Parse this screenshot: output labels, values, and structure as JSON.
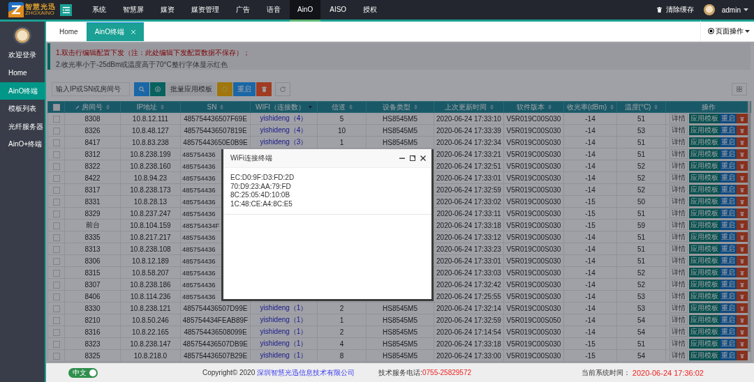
{
  "top_nav": {
    "logo": {
      "title": "智慧光迅",
      "subtitle": "ZHGXAINO"
    },
    "items": [
      {
        "label": "系统",
        "selected": false
      },
      {
        "label": "智慧屏",
        "selected": false
      },
      {
        "label": "媒资",
        "selected": false
      },
      {
        "label": "媒资管理",
        "selected": false
      },
      {
        "label": "广告",
        "selected": false
      },
      {
        "label": "语音",
        "selected": false
      },
      {
        "label": "AinO",
        "selected": true
      },
      {
        "label": "AISO",
        "selected": false
      },
      {
        "label": "授权",
        "selected": false
      }
    ],
    "clear_cache": "清除缓存",
    "user": "admin"
  },
  "sidebar": {
    "welcome": "欢迎登录",
    "items": [
      {
        "label": "Home",
        "selected": false
      },
      {
        "label": "AinO终端",
        "selected": true
      },
      {
        "label": "模板列表",
        "selected": false
      },
      {
        "label": "光纤服务器",
        "selected": false
      },
      {
        "label": "AinO+终端",
        "selected": false
      }
    ]
  },
  "tabs": [
    {
      "label": "Home",
      "selected": false,
      "closable": false
    },
    {
      "label": "AinO终端",
      "selected": true,
      "closable": true
    }
  ],
  "page_actions": "页面操作",
  "notice": [
    {
      "text": "1.双击行编辑配置下发（注：此处编辑下发配置数据不保存）；",
      "kind": "warning"
    },
    {
      "text": "2.收光率小于-25dBm或温度高于70°C整行字体显示红色",
      "kind": "info"
    }
  ],
  "toolbar": {
    "search_placeholder": "输入IP或SN或房间号",
    "batch_label": "批量应用模板",
    "restart": "重启"
  },
  "table": {
    "select_all": {
      "checked": false
    },
    "columns": [
      {
        "label": "房间号",
        "editable": true,
        "sortable": true,
        "sorted": false
      },
      {
        "label": "IP地址",
        "editable": false,
        "sortable": true,
        "sorted": false
      },
      {
        "label": "SN",
        "editable": false,
        "sortable": true,
        "sorted": false
      },
      {
        "label": "WIFI（连接数）",
        "editable": false,
        "sortable": true,
        "sorted": true
      },
      {
        "label": "信道",
        "editable": false,
        "sortable": true,
        "sorted": false
      },
      {
        "label": "设备类型",
        "editable": false,
        "sortable": true,
        "sorted": false
      },
      {
        "label": "上次更新时间",
        "editable": false,
        "sortable": true,
        "sorted": false
      },
      {
        "label": "软件版本",
        "editable": false,
        "sortable": true,
        "sorted": false
      },
      {
        "label": "收光率(dBm)",
        "editable": false,
        "sortable": true,
        "sorted": false
      },
      {
        "label": "温度(°C)",
        "editable": false,
        "sortable": true,
        "sorted": false
      },
      {
        "label": "操作",
        "editable": false,
        "sortable": false
      }
    ],
    "rows": [
      {
        "checked": false,
        "room": "8308",
        "ip": "10.8.12.111",
        "sn": "485754436507F69E",
        "wifi": "yishideng（4）",
        "channel": "5",
        "device_type": "HS8545M5",
        "updated": "2020-06-24 17:33:10",
        "firmware": "V5R019C00S030",
        "rx_power": "-14",
        "temperature": "51",
        "actions": [
          "详情",
          "应用模板",
          "重启"
        ]
      },
      {
        "checked": false,
        "room": "8326",
        "ip": "10.8.48.127",
        "sn": "485754436507819E",
        "wifi": "yishideng（4）",
        "channel": "10",
        "device_type": "HS8545M5",
        "updated": "2020-06-24 17:33:39",
        "firmware": "V5R019C00S030",
        "rx_power": "-14",
        "temperature": "53",
        "actions": [
          "详情",
          "应用模板",
          "重启"
        ]
      },
      {
        "checked": false,
        "room": "8417",
        "ip": "10.8.83.238",
        "sn": "48575443650E0B9E",
        "wifi": "yishideng（3）",
        "channel": "1",
        "device_type": "HS8545M5",
        "updated": "2020-06-24 17:32:34",
        "firmware": "V5R019C00S030",
        "rx_power": "-14",
        "temperature": "51",
        "actions": [
          "详情",
          "应用模板",
          "重启"
        ]
      },
      {
        "checked": false,
        "room": "8312",
        "ip": "10.8.238.199",
        "sn": "485754436",
        "updated": "2020-06-24 17:33:21",
        "firmware": "V5R019C00S030",
        "rx_power": "-14",
        "temperature": "51",
        "actions": [
          "详情",
          "应用模板",
          "重启"
        ]
      },
      {
        "checked": false,
        "room": "8322",
        "ip": "10.8.238.160",
        "sn": "485754436",
        "updated": "2020-06-24 17:32:51",
        "firmware": "V5R019C00S030",
        "rx_power": "-14",
        "temperature": "52",
        "actions": [
          "详情",
          "应用模板",
          "重启"
        ]
      },
      {
        "checked": false,
        "room": "8422",
        "ip": "10.8.94.23",
        "sn": "485754436",
        "updated": "2020-06-24 17:33:01",
        "firmware": "V5R019C00S030",
        "rx_power": "-14",
        "temperature": "52",
        "actions": [
          "详情",
          "应用模板",
          "重启"
        ]
      },
      {
        "checked": false,
        "room": "8317",
        "ip": "10.8.238.173",
        "sn": "485754436",
        "updated": "2020-06-24 17:32:59",
        "firmware": "V5R019C00S030",
        "rx_power": "-14",
        "temperature": "52",
        "actions": [
          "详情",
          "应用模板",
          "重启"
        ]
      },
      {
        "checked": false,
        "room": "8331",
        "ip": "10.8.28.13",
        "sn": "485754436",
        "updated": "2020-06-24 17:33:02",
        "firmware": "V5R019C00S030",
        "rx_power": "-15",
        "temperature": "50",
        "actions": [
          "详情",
          "应用模板",
          "重启"
        ]
      },
      {
        "checked": false,
        "room": "8329",
        "ip": "10.8.237.247",
        "sn": "485754436",
        "updated": "2020-06-24 17:33:11",
        "firmware": "V5R019C00S030",
        "rx_power": "-15",
        "temperature": "51",
        "actions": [
          "详情",
          "应用模板",
          "重启"
        ]
      },
      {
        "checked": false,
        "room": "前台",
        "ip": "10.8.104.159",
        "sn": "485754434F",
        "updated": "2020-06-24 17:33:18",
        "firmware": "V5R019C00S030",
        "rx_power": "-15",
        "temperature": "59",
        "actions": [
          "详情",
          "应用模板",
          "重启"
        ]
      },
      {
        "checked": false,
        "room": "8335",
        "ip": "10.8.217.217",
        "sn": "485754436",
        "updated": "2020-06-24 17:33:12",
        "firmware": "V5R019C00S030",
        "rx_power": "-14",
        "temperature": "51",
        "actions": [
          "详情",
          "应用模板",
          "重启"
        ]
      },
      {
        "checked": false,
        "room": "8313",
        "ip": "10.8.238.108",
        "sn": "485754436",
        "updated": "2020-06-24 17:33:23",
        "firmware": "V5R019C00S030",
        "rx_power": "-14",
        "temperature": "51",
        "actions": [
          "详情",
          "应用模板",
          "重启"
        ]
      },
      {
        "checked": false,
        "room": "8306",
        "ip": "10.8.12.189",
        "sn": "485754436",
        "updated": "2020-06-24 17:33:01",
        "firmware": "V5R019C00S030",
        "rx_power": "-14",
        "temperature": "51",
        "actions": [
          "详情",
          "应用模板",
          "重启"
        ]
      },
      {
        "checked": false,
        "room": "8315",
        "ip": "10.8.58.207",
        "sn": "485754436",
        "updated": "2020-06-24 17:33:03",
        "firmware": "V5R019C00S030",
        "rx_power": "-14",
        "temperature": "52",
        "actions": [
          "详情",
          "应用模板",
          "重启"
        ]
      },
      {
        "checked": false,
        "room": "8307",
        "ip": "10.8.238.186",
        "sn": "485754436",
        "updated": "2020-06-24 17:32:42",
        "firmware": "V5R019C00S030",
        "rx_power": "-14",
        "temperature": "52",
        "actions": [
          "详情",
          "应用模板",
          "重启"
        ]
      },
      {
        "checked": false,
        "room": "8406",
        "ip": "10.8.114.236",
        "sn": "485754436",
        "updated": "2020-06-24 17:25:55",
        "firmware": "V5R019C00S030",
        "rx_power": "-14",
        "temperature": "53",
        "actions": [
          "详情",
          "应用模板",
          "重启"
        ]
      },
      {
        "checked": false,
        "room": "8330",
        "ip": "10.8.238.121",
        "sn": "485754436507D99E",
        "wifi": "yishideng（1）",
        "channel": "2",
        "device_type": "HS8545M5",
        "updated": "2020-06-24 17:32:14",
        "firmware": "V5R019C00S030",
        "rx_power": "-14",
        "temperature": "53",
        "actions": [
          "详情",
          "应用模板",
          "重启"
        ]
      },
      {
        "checked": false,
        "room": "8210",
        "ip": "10.8.50.246",
        "sn": "485754434FEAB89F",
        "wifi": "yishideng（1）",
        "channel": "1",
        "device_type": "HS8545M5",
        "updated": "2020-06-24 17:32:59",
        "firmware": "V5R019C00S050",
        "rx_power": "-14",
        "temperature": "54",
        "actions": [
          "详情",
          "应用模板",
          "重启"
        ]
      },
      {
        "checked": false,
        "room": "8316",
        "ip": "10.8.22.165",
        "sn": "485754436508099E",
        "wifi": "yishideng（1）",
        "channel": "2",
        "device_type": "HS8545M5",
        "updated": "2020-06-24 17:14:54",
        "firmware": "V5R019C00S030",
        "rx_power": "-14",
        "temperature": "54",
        "actions": [
          "详情",
          "应用模板",
          "重启"
        ]
      },
      {
        "checked": false,
        "room": "8323",
        "ip": "10.8.238.147",
        "sn": "485754436507DB9E",
        "wifi": "yishideng（1）",
        "channel": "4",
        "device_type": "HS8545M5",
        "updated": "2020-06-24 17:33:18",
        "firmware": "V5R019C00S030",
        "rx_power": "-15",
        "temperature": "51",
        "actions": [
          "详情",
          "应用模板",
          "重启"
        ]
      },
      {
        "checked": false,
        "room": "8325",
        "ip": "10.8.218.0",
        "sn": "485754436507B29E",
        "wifi": "yishideng（1）",
        "channel": "8",
        "device_type": "HS8545M5",
        "updated": "2020-06-24 17:33:00",
        "firmware": "V5R019C00S030",
        "rx_power": "-15",
        "temperature": "54",
        "actions": [
          "详情",
          "应用模板",
          "重启"
        ]
      }
    ]
  },
  "modal": {
    "title": "WiFi连接终端",
    "lines": [
      "EC:D0:9F:D3:FD:2D",
      "70:D9:23:AA:79:FD",
      "8C:25:05:4D:10:0B",
      "1C:48:CE:A4:8C:E5"
    ]
  },
  "footer": {
    "language": {
      "label": "中文",
      "on": true
    },
    "copyright": "Copyright© 2020",
    "company": "深圳智慧光迅信息技术有限公司",
    "phone_label": "技术服务电话:",
    "phone": "0755-25829572",
    "time_label": "当前系统时间：",
    "time": "2020-06-24 17:36:02"
  }
}
